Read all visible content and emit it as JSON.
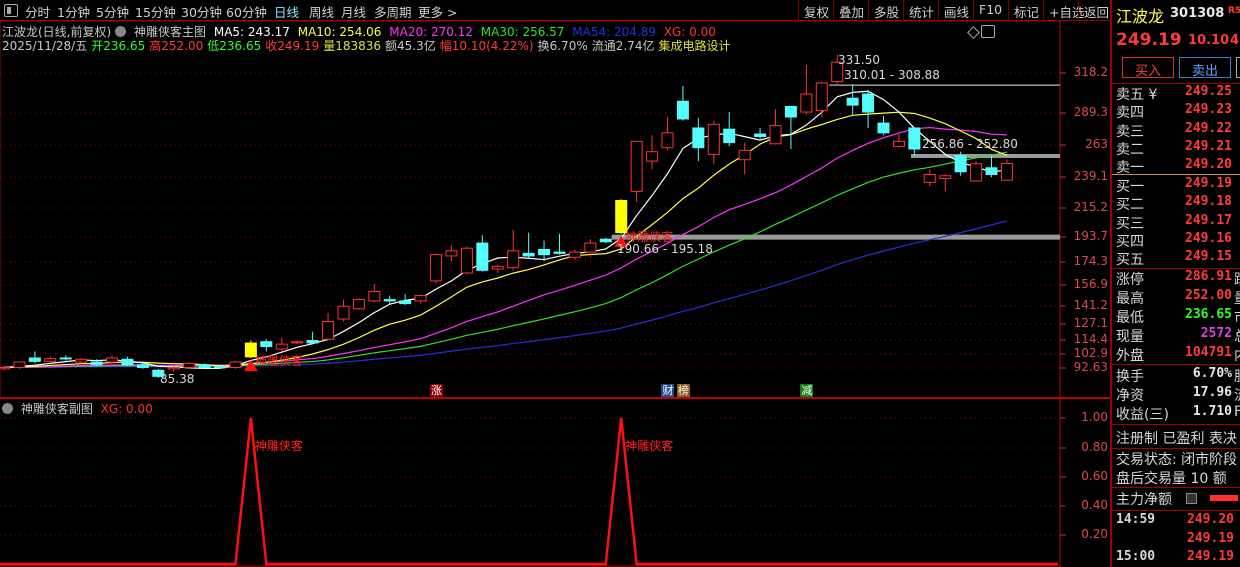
{
  "topbar": {
    "periods": [
      "分时",
      "1分钟",
      "5分钟",
      "15分钟",
      "30分钟",
      "60分钟",
      "日线",
      "周线",
      "月线",
      "多周期",
      "更多 >"
    ],
    "active_period": "日线",
    "buttons": [
      "复权",
      "叠加",
      "多股",
      "统计",
      "画线",
      "F10",
      "标记",
      "+自选",
      "返回"
    ]
  },
  "info": {
    "title": "江波龙(日线,前复权)",
    "indicator": "神雕侠客主图",
    "ma5": "MA5: 243.17",
    "ma10": "MA10: 254.06",
    "ma20": "MA20: 270.12",
    "ma30": "MA30: 256.57",
    "ma54": "MA54: 204.89",
    "xg": "XG: 0.00",
    "date": "2025/11/28/五",
    "open": "开236.65",
    "high": "高252.00",
    "low": "低236.65",
    "close": "收249.19",
    "volume": "量183836",
    "amount": "额45.3亿",
    "change": "幅10.10(4.22%)",
    "turnover": "换6.70%",
    "float": "流通2.74亿",
    "sector": "集成电路设计"
  },
  "sub": {
    "title": "神雕侠客副图",
    "xg": "XG: 0.00"
  },
  "colors": {
    "up": "#ff3232",
    "down": "#54fcfc",
    "signal": "#ffff00",
    "ma5": "#ffffff",
    "ma10": "#ffff40",
    "ma20": "#ff30ff",
    "ma30": "#30e030",
    "ma54": "#2030e0",
    "grid": "#8a0000"
  },
  "chart_data": {
    "type": "candlestick",
    "price_ticks": [
      318.2,
      289.3,
      263.0,
      239.1,
      215.2,
      193.7,
      174.3,
      156.9,
      141.2,
      127.1,
      114.4,
      102.9,
      92.63
    ],
    "sub_ticks": [
      "1.00",
      "0.80",
      "0.60",
      "0.40",
      "0.20"
    ],
    "candles_ohlc": [
      [
        92,
        94,
        91,
        93
      ],
      [
        93,
        97.5,
        92,
        97
      ],
      [
        100,
        105,
        96,
        97.5
      ],
      [
        97.5,
        101,
        97,
        99.5
      ],
      [
        100,
        102,
        98,
        99.5
      ],
      [
        97,
        100,
        96,
        99
      ],
      [
        97,
        99,
        94,
        95
      ],
      [
        97,
        102,
        96,
        100
      ],
      [
        99,
        101,
        94,
        95
      ],
      [
        95,
        96,
        92,
        93
      ],
      [
        91,
        92,
        85.38,
        86.5
      ],
      [
        92,
        94,
        90,
        93
      ],
      [
        93,
        97,
        92,
        96
      ],
      [
        95,
        96,
        92,
        93
      ],
      [
        93.5,
        94.5,
        92,
        93
      ],
      [
        93,
        98,
        92,
        97
      ],
      [
        100.8,
        114,
        100,
        111.9
      ],
      [
        113,
        115,
        105,
        109
      ],
      [
        107,
        116,
        105,
        111
      ],
      [
        112,
        114,
        111,
        113
      ],
      [
        114,
        121,
        111,
        112
      ],
      [
        115,
        135.7,
        114,
        129
      ],
      [
        131,
        146,
        129,
        141
      ],
      [
        139,
        147,
        138,
        146
      ],
      [
        145,
        157.6,
        144,
        152
      ],
      [
        146,
        149,
        143,
        145
      ],
      [
        145,
        150,
        142,
        143
      ],
      [
        145,
        150,
        143,
        149
      ],
      [
        160,
        181,
        158,
        180
      ],
      [
        179,
        187,
        175,
        183
      ],
      [
        166,
        186,
        165,
        185
      ],
      [
        189,
        195,
        167,
        168
      ],
      [
        169,
        172,
        166,
        171
      ],
      [
        170,
        199,
        168,
        183
      ],
      [
        181,
        197,
        177,
        179
      ],
      [
        184,
        191,
        175,
        180
      ],
      [
        182,
        196,
        180,
        181
      ],
      [
        178,
        184,
        176,
        182
      ],
      [
        182,
        192,
        178,
        189
      ],
      [
        192,
        193,
        189,
        190
      ],
      [
        197,
        222,
        196,
        221
      ],
      [
        228,
        266,
        220,
        266
      ],
      [
        251,
        271,
        245,
        258
      ],
      [
        261,
        286,
        259,
        273
      ],
      [
        297.8,
        308.8,
        283,
        284.4
      ],
      [
        277,
        285,
        251,
        261
      ],
      [
        256,
        283,
        249,
        280
      ],
      [
        276,
        290,
        262,
        265
      ],
      [
        252,
        265,
        241,
        259
      ],
      [
        272,
        277,
        268,
        270
      ],
      [
        264,
        292,
        264,
        279
      ],
      [
        294,
        294,
        260,
        286
      ],
      [
        290,
        324,
        288,
        303
      ],
      [
        291,
        312,
        286,
        311
      ],
      [
        312,
        331.5,
        309,
        326
      ],
      [
        300,
        310,
        288,
        295
      ],
      [
        303,
        306,
        277,
        290
      ],
      [
        281,
        287,
        271,
        273
      ],
      [
        262,
        272,
        261,
        266
      ],
      [
        277,
        277,
        255,
        260
      ],
      [
        235,
        245,
        232,
        241
      ],
      [
        238,
        241,
        228,
        240
      ],
      [
        255,
        258,
        240,
        243
      ],
      [
        236,
        251,
        236,
        249
      ],
      [
        246,
        255,
        239,
        241
      ],
      [
        236.65,
        252,
        236.65,
        249.19
      ]
    ],
    "signal_candles": [
      16,
      40
    ],
    "signal_label": "神雕侠客",
    "sub_series": "XG",
    "annotations": {
      "high": "331.50",
      "low": "85.38",
      "range_top": "310.01 - 308.88",
      "range_mid": "256.86 - 252.80",
      "range_low": "190.66 - 195.18"
    },
    "events": [
      {
        "label": "涨",
        "day": 28,
        "bg": "#8a0000"
      },
      {
        "label": "财",
        "day": 43,
        "bg": "#1c4f8f"
      },
      {
        "label": "榜",
        "day": 44,
        "bg": "#8a5a20"
      },
      {
        "label": "减",
        "day": 52,
        "bg": "#1a7a1a"
      }
    ]
  },
  "quote": {
    "name": "江波龙",
    "code": "301308",
    "tag": "R500",
    "price": "249.19",
    "change": "10.10",
    "pct": "4.",
    "buy_label": "买入",
    "sell_label": "卖出",
    "asks": [
      {
        "l": "卖五 ¥",
        "v": "249.25"
      },
      {
        "l": "卖四",
        "v": "249.23"
      },
      {
        "l": "卖三",
        "v": "249.22"
      },
      {
        "l": "卖二",
        "v": "249.21"
      },
      {
        "l": "卖一",
        "v": "249.20"
      }
    ],
    "bids": [
      {
        "l": "买一",
        "v": "249.19"
      },
      {
        "l": "买二",
        "v": "249.18"
      },
      {
        "l": "买三",
        "v": "249.17"
      },
      {
        "l": "买四",
        "v": "249.16"
      },
      {
        "l": "买五",
        "v": "249.15"
      }
    ],
    "stats": [
      {
        "l": "涨停",
        "v": "286.91",
        "c": "red",
        "cut": "跌"
      },
      {
        "l": "最高",
        "v": "252.00",
        "c": "red",
        "cut": "量"
      },
      {
        "l": "最低",
        "v": "236.65",
        "c": "green",
        "cut": "市"
      },
      {
        "l": "现量",
        "v": "2572",
        "c": "purple",
        "cut": "总"
      },
      {
        "l": "外盘",
        "v": "104791",
        "c": "red",
        "cut": "内"
      }
    ],
    "fin": [
      {
        "l": "换手",
        "v": "6.70%",
        "cut": "股"
      },
      {
        "l": "净资",
        "v": "17.96",
        "cut": "流"
      },
      {
        "l": "收益(三)",
        "v": "1.710",
        "cut": "F"
      }
    ],
    "tags": "注册制 已盈利 表决",
    "status": "交易状态: 闭市阶段",
    "after_hours": "盘后交易量 10 额",
    "main_net": "主力净额",
    "ticks": [
      {
        "t": "14:59",
        "v": "249.20"
      },
      {
        "t": "",
        "v": "249.19"
      },
      {
        "t": "15:00",
        "v": "249.19"
      }
    ]
  }
}
